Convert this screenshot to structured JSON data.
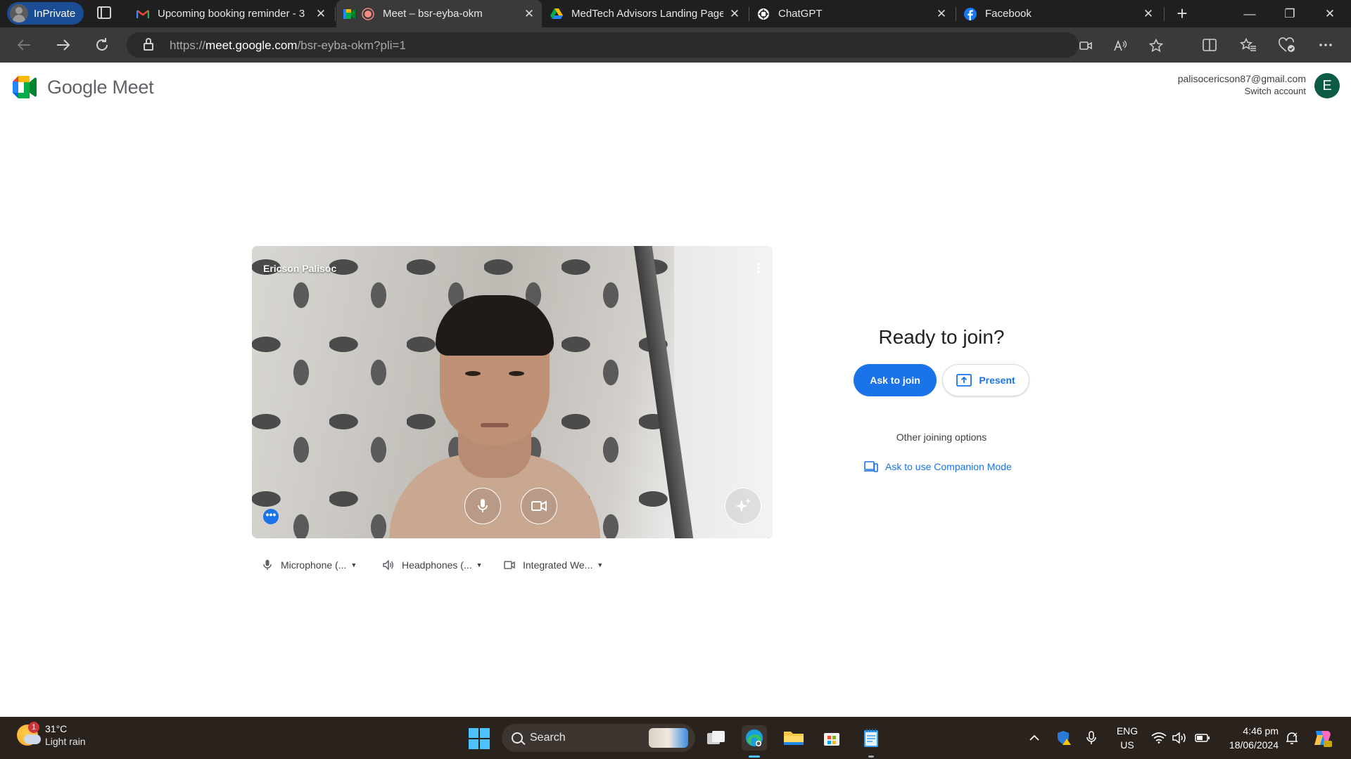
{
  "browser": {
    "inprivate_label": "InPrivate",
    "tabs": [
      {
        "title": "Upcoming booking reminder - 3",
        "favicon": "gmail-icon",
        "close": "✕"
      },
      {
        "title": "Meet – bsr-eyba-okm",
        "favicon": "meet-icon",
        "close": "✕",
        "active": true
      },
      {
        "title": "MedTech Advisors Landing Page",
        "favicon": "drive-icon",
        "close": "✕"
      },
      {
        "title": "ChatGPT",
        "favicon": "chatgpt-icon",
        "close": "✕"
      },
      {
        "title": "Facebook",
        "favicon": "facebook-icon",
        "close": "✕"
      }
    ],
    "new_tab": "+",
    "window_controls": {
      "minimize": "—",
      "restore": "❐",
      "close": "✕"
    },
    "url_prefix": "https://",
    "url_host": "meet.google.com",
    "url_path": "/bsr-eyba-okm?pli=1"
  },
  "meet": {
    "brand_google": "Google",
    "brand_meet": "Meet",
    "account_email": "palisocericson87@gmail.com",
    "switch_account": "Switch account",
    "avatar_letter": "E",
    "participant_name": "Ericson Palisoc",
    "more_options": "⋮",
    "ready_title": "Ready to join?",
    "ask_to_join": "Ask to join",
    "present": "Present",
    "other_options": "Other joining options",
    "companion_mode": "Ask to use Companion Mode",
    "devices": {
      "microphone": "Microphone (...",
      "speaker": "Headphones (...",
      "camera": "Integrated We..."
    },
    "accent_color": "#1a73e8"
  },
  "taskbar": {
    "weather_temp": "31°C",
    "weather_condition": "Light rain",
    "weather_badge": "1",
    "search_label": "Search",
    "lang_top": "ENG",
    "lang_bottom": "US",
    "time": "4:46 pm",
    "date": "18/06/2024"
  }
}
